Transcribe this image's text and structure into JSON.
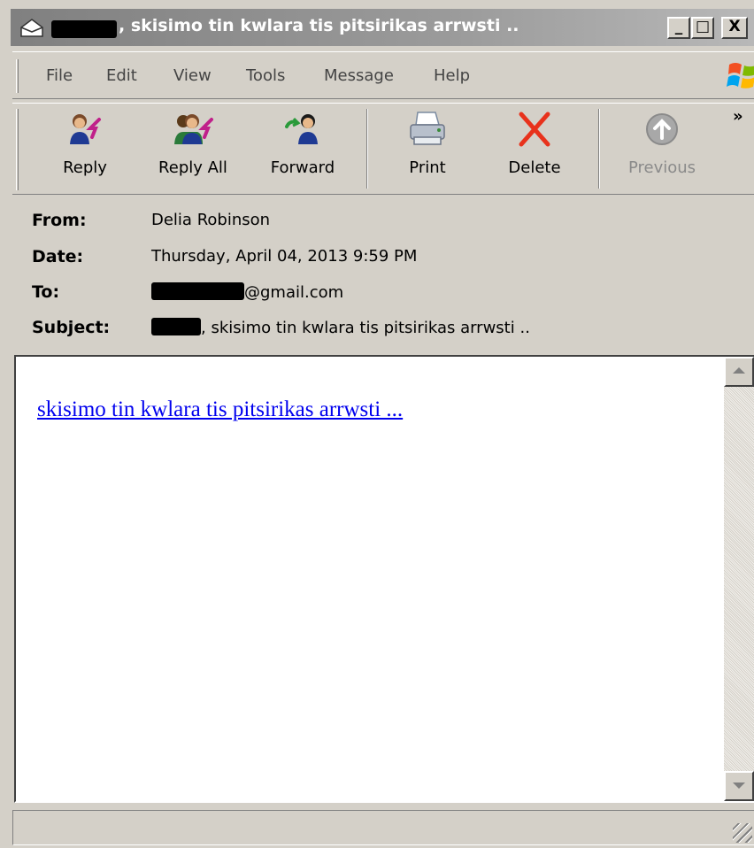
{
  "window": {
    "title": ", skisimo tin kwlara tis pitsirikas arrwsti ..",
    "controls": {
      "minimize": "_",
      "maximize": "□",
      "close": "X"
    }
  },
  "menu": [
    "File",
    "Edit",
    "View",
    "Tools",
    "Message",
    "Help"
  ],
  "toolbar": {
    "reply": "Reply",
    "reply_all": "Reply All",
    "forward": "Forward",
    "print": "Print",
    "delete": "Delete",
    "previous": "Previous",
    "overflow": "»"
  },
  "header": {
    "from_label": "From:",
    "from_value": "Delia Robinson",
    "date_label": "Date:",
    "date_value": "Thursday, April 04, 2013 9:59 PM",
    "to_label": "To:",
    "to_value": "@gmail.com",
    "subject_label": "Subject:",
    "subject_value": ", skisimo tin kwlara tis pitsirikas arrwsti .."
  },
  "message": {
    "link_text": "skisimo tin kwlara tis pitsirikas arrwsti ..."
  },
  "colors": {
    "chrome": "#d4d0c8",
    "link": "#0000ee",
    "delete_x": "#e8321c",
    "title_bar": "#909090"
  }
}
